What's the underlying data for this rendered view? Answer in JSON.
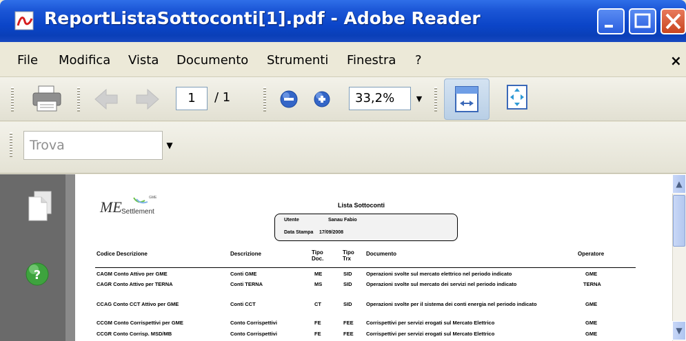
{
  "window": {
    "title": "ReportListaSottoconti[1].pdf - Adobe Reader",
    "accent": "#0b45c8"
  },
  "menu": {
    "items": [
      "File",
      "Modifica",
      "Vista",
      "Documento",
      "Strumenti",
      "Finestra",
      "?"
    ],
    "close_glyph": "×"
  },
  "toolbar": {
    "page_current": "1",
    "page_total": "/ 1",
    "zoom": "33,2%",
    "icons": [
      "print-icon",
      "previous-page-icon",
      "next-page-icon",
      "zoom-out-icon",
      "zoom-in-icon",
      "fit-width-icon",
      "fit-page-icon"
    ]
  },
  "find": {
    "placeholder": "Trova"
  },
  "document": {
    "logo": {
      "main": "ME",
      "sub": "Settlement",
      "tag": "GME"
    },
    "title": "Lista Sottoconti",
    "meta": {
      "user_label": "Utente",
      "user_value": "Sanau Fabio",
      "date_label": "Data Stampa",
      "date_value": "17/09/2008"
    },
    "columns": {
      "codice": "Codice Descrizione",
      "descrizione": "Descrizione",
      "tipo_doc": "Tipo Doc.",
      "tipo_trx": "Tipo Trx",
      "documento": "Documento",
      "operatore": "Operatore"
    },
    "rows": [
      {
        "codice": "CAGM Conto Attivo per GME",
        "descrizione": "Conti GME",
        "tipo_doc": "ME",
        "tipo_trx": "SID",
        "documento": "Operazioni svolte sul mercato elettrico nel periodo indicato",
        "operatore": "GME"
      },
      {
        "codice": "CAGR Conto Attivo per TERNA",
        "descrizione": "Conti TERNA",
        "tipo_doc": "MS",
        "tipo_trx": "SID",
        "documento": "Operazioni svolte sul mercato dei servizi nel periodo indicato",
        "operatore": "TERNA"
      },
      {
        "codice": "CCAG Conto CCT Attivo per GME",
        "descrizione": "Conti CCT",
        "tipo_doc": "CT",
        "tipo_trx": "SID",
        "documento": "Operazioni svolte per il sistema dei conti energia nel periodo indicato",
        "operatore": "GME"
      },
      {
        "codice": "CCGM Conto Corrispettivi per GME",
        "descrizione": "Conto Corrispettivi",
        "tipo_doc": "FE",
        "tipo_trx": "FEE",
        "documento": "Corrispettivi per servizi erogati sul Mercato Elettrico",
        "operatore": "GME"
      },
      {
        "codice": "CCGR Conto Corrisp. MSD/MB",
        "descrizione": "Conto Corrispettivi",
        "tipo_doc": "FE",
        "tipo_trx": "FEE",
        "documento": "Corrispettivi per servizi erogati sul Mercato Elettrico",
        "operatore": "GME"
      }
    ]
  }
}
